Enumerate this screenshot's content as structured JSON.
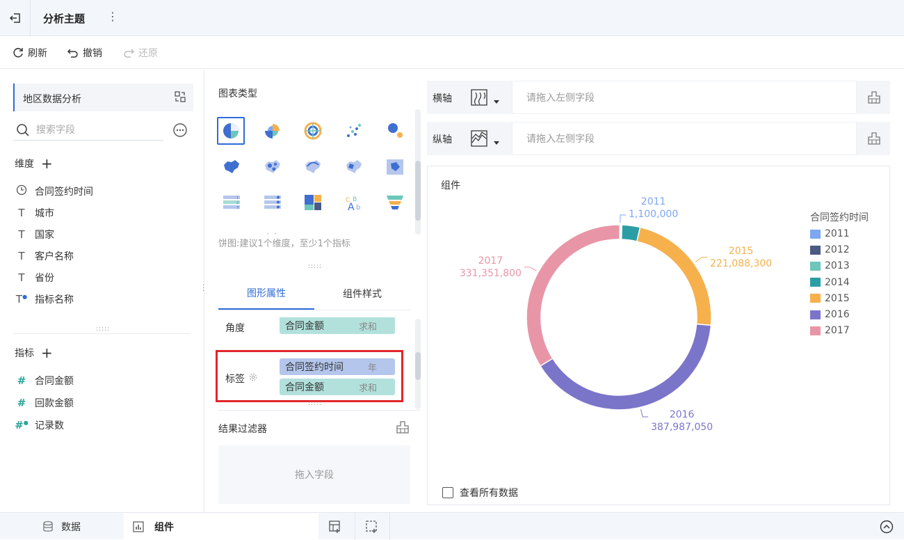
{
  "header": {
    "title": "分析主题"
  },
  "toolbar": {
    "refresh": "刷新",
    "undo": "撤销",
    "redo": "还原"
  },
  "left": {
    "dataset_name": "地区数据分析",
    "search_placeholder": "搜索字段",
    "dimensions_label": "维度",
    "dimensions": [
      {
        "label": "合同签约时间",
        "icon": "clock-icon"
      },
      {
        "label": "城市",
        "icon": "text-type-icon"
      },
      {
        "label": "国家",
        "icon": "text-type-icon"
      },
      {
        "label": "客户名称",
        "icon": "text-type-icon"
      },
      {
        "label": "省份",
        "icon": "text-type-icon"
      },
      {
        "label": "指标名称",
        "icon": "calc-text-type-icon"
      }
    ],
    "metrics_label": "指标",
    "metrics": [
      {
        "label": "合同金额",
        "icon": "number-type-icon"
      },
      {
        "label": "回款金额",
        "icon": "number-type-icon"
      },
      {
        "label": "记录数",
        "icon": "calc-number-type-icon"
      }
    ]
  },
  "middle": {
    "chart_type_title": "图表类型",
    "chart_hint": "饼图:建议1个维度，至少1个指标",
    "tabs": [
      "图形属性",
      "组件样式"
    ],
    "angle_label": "角度",
    "angle_field": {
      "name": "合同金额",
      "agg": "求和"
    },
    "label_label": "标签",
    "label_fields": [
      {
        "name": "合同签约时间",
        "agg": "年"
      },
      {
        "name": "合同金额",
        "agg": "求和"
      }
    ],
    "filter_title": "结果过滤器",
    "filter_placeholder": "拖入字段"
  },
  "axes": {
    "x_label": "横轴",
    "y_label": "纵轴",
    "placeholder": "请拖入左侧字段"
  },
  "chart": {
    "title": "组件",
    "view_all": "查看所有数据"
  },
  "status": {
    "data_tab": "数据",
    "widget_tab": "组件"
  },
  "chart_data": {
    "type": "pie",
    "donut": true,
    "title": "组件",
    "legend_title": "合同签约时间",
    "legend_position": "right",
    "categories": [
      "2011",
      "2012",
      "2013",
      "2014",
      "2015",
      "2016",
      "2017"
    ],
    "values": [
      1100000,
      1500000,
      900000,
      31000000,
      221088300,
      387987050,
      331351800
    ],
    "value_labels": [
      "1,100,000",
      "",
      "",
      "",
      "221,088,300",
      "387,987,050",
      "331,351,800"
    ],
    "colors": [
      "#7da6f3",
      "#4a5a85",
      "#6cc7b9",
      "#2a9ea4",
      "#f6b04c",
      "#7b75c9",
      "#e896a7"
    ]
  }
}
